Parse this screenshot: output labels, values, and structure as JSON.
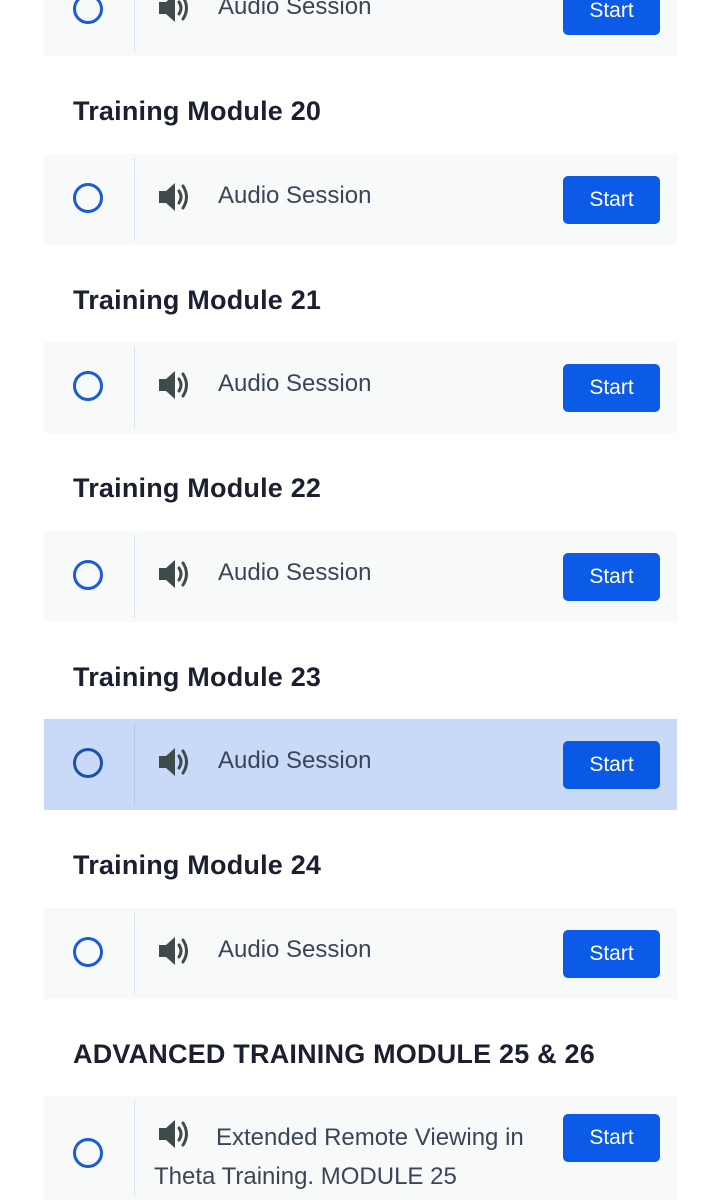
{
  "modules": [
    {
      "title": "",
      "lesson": {
        "label": "Audio Session",
        "button": "Start",
        "selected": false
      }
    },
    {
      "title": "Training Module 20",
      "lesson": {
        "label": "Audio Session",
        "button": "Start",
        "selected": false
      }
    },
    {
      "title": "Training Module 21",
      "lesson": {
        "label": "Audio Session",
        "button": "Start",
        "selected": false
      }
    },
    {
      "title": "Training Module 22",
      "lesson": {
        "label": "Audio Session",
        "button": "Start",
        "selected": false
      }
    },
    {
      "title": "Training Module 23",
      "lesson": {
        "label": "Audio Session",
        "button": "Start",
        "selected": true
      }
    },
    {
      "title": "Training Module 24",
      "lesson": {
        "label": "Audio Session",
        "button": "Start",
        "selected": false
      }
    },
    {
      "title": "ADVANCED TRAINING MODULE 25 & 26",
      "lesson": {
        "label": "Extended Remote Viewing in Theta Training. MODULE 25",
        "button": "Start",
        "selected": false
      }
    }
  ],
  "icons": {
    "status": "circle-outline-icon",
    "lesson_type": "speaker-icon"
  },
  "colors": {
    "accent": "#0b5ae8",
    "status_ring": "#1a5bd6",
    "row_background": "#f8f9f9",
    "row_selected": "#c8daf8",
    "title_text": "#1b1f2e",
    "lesson_text": "#3a4656"
  }
}
